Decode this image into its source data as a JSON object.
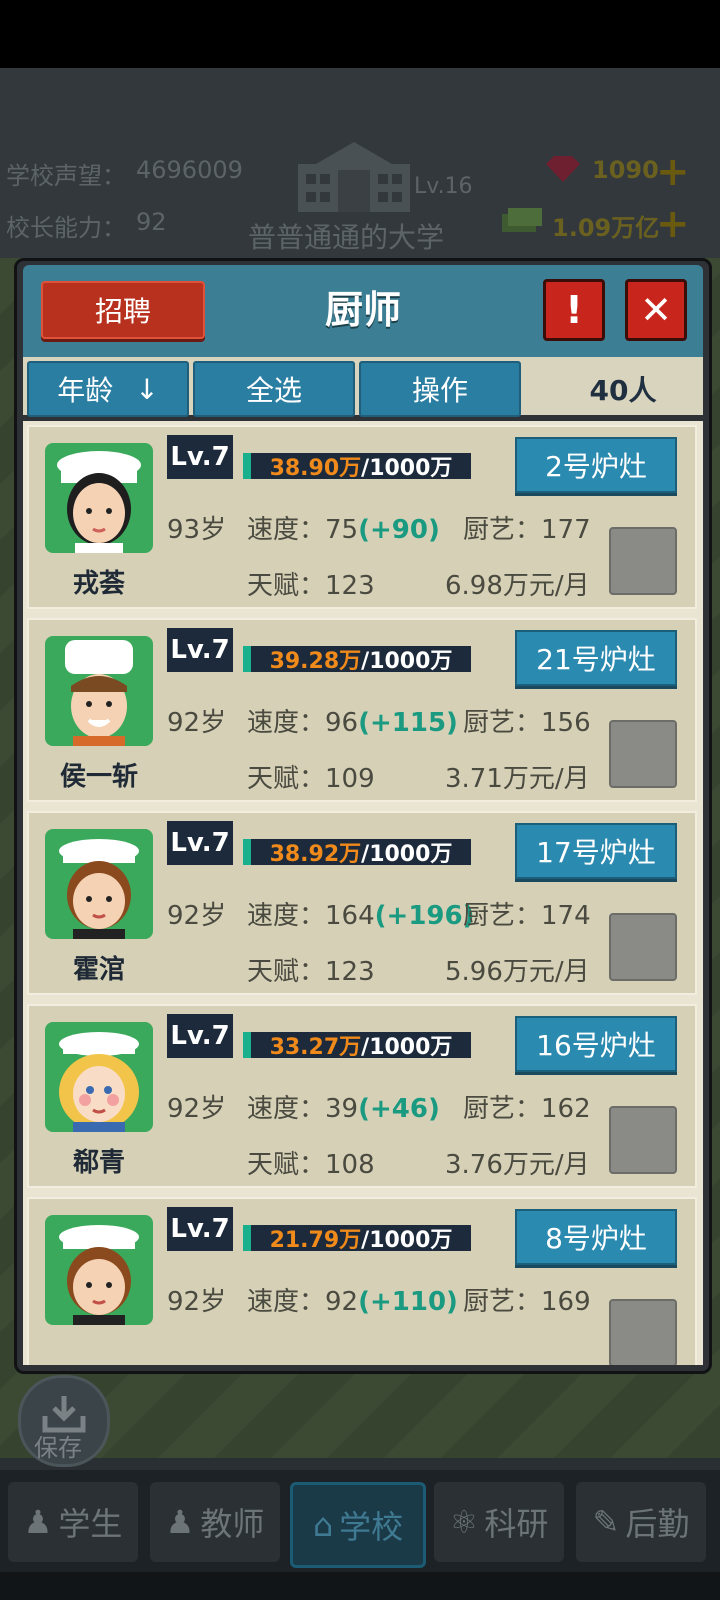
{
  "hud": {
    "reputation_label": "学校声望：",
    "reputation_value": "4696009",
    "principal_label": "校长能力：",
    "principal_value": "92",
    "school_level": "Lv.16",
    "school_name": "普普通通的大学",
    "gems": "1090",
    "money": "1.09万亿"
  },
  "panel": {
    "title": "厨师",
    "recruit_label": "招聘",
    "alert_label": "!",
    "close_label": "✕",
    "toolbar": {
      "sort_label": "年龄",
      "sort_arrow": "↓",
      "select_all_label": "全选",
      "operate_label": "操作",
      "count": "40人"
    }
  },
  "labels": {
    "speed": "速度：",
    "skill": "厨艺：",
    "talent": "天赋："
  },
  "chefs": [
    {
      "name": "戎荟",
      "level": "Lv.7",
      "exp_cur": "38.90万",
      "exp_max": "/1000万",
      "stove": "2号炉灶",
      "age": "93岁",
      "speed": "75",
      "speed_bonus": "(+90)",
      "skill": "177",
      "talent": "123",
      "salary": "6.98万元/月"
    },
    {
      "name": "侯一斩",
      "level": "Lv.7",
      "exp_cur": "39.28万",
      "exp_max": "/1000万",
      "stove": "21号炉灶",
      "age": "92岁",
      "speed": "96",
      "speed_bonus": "(+115)",
      "skill": "156",
      "talent": "109",
      "salary": "3.71万元/月"
    },
    {
      "name": "霍涫",
      "level": "Lv.7",
      "exp_cur": "38.92万",
      "exp_max": "/1000万",
      "stove": "17号炉灶",
      "age": "92岁",
      "speed": "164",
      "speed_bonus": "(+196)",
      "skill": "174",
      "talent": "123",
      "salary": "5.96万元/月"
    },
    {
      "name": "郗青",
      "level": "Lv.7",
      "exp_cur": "33.27万",
      "exp_max": "/1000万",
      "stove": "16号炉灶",
      "age": "92岁",
      "speed": "39",
      "speed_bonus": "(+46)",
      "skill": "162",
      "talent": "108",
      "salary": "3.76万元/月"
    },
    {
      "name": "",
      "level": "Lv.7",
      "exp_cur": "21.79万",
      "exp_max": "/1000万",
      "stove": "8号炉灶",
      "age": "92岁",
      "speed": "92",
      "speed_bonus": "(+110)",
      "skill": "169",
      "talent": "",
      "salary": ""
    }
  ],
  "save_label": "保存",
  "nav": {
    "students": "学生",
    "teachers": "教师",
    "school": "学校",
    "research": "科研",
    "logistics": "后勤"
  },
  "colors": {
    "header": "#3c7f94",
    "accent_red": "#c8261c",
    "stove_button": "#2a8ab0",
    "bonus_green": "#1a9a80",
    "exp_orange": "#f08a1a"
  }
}
